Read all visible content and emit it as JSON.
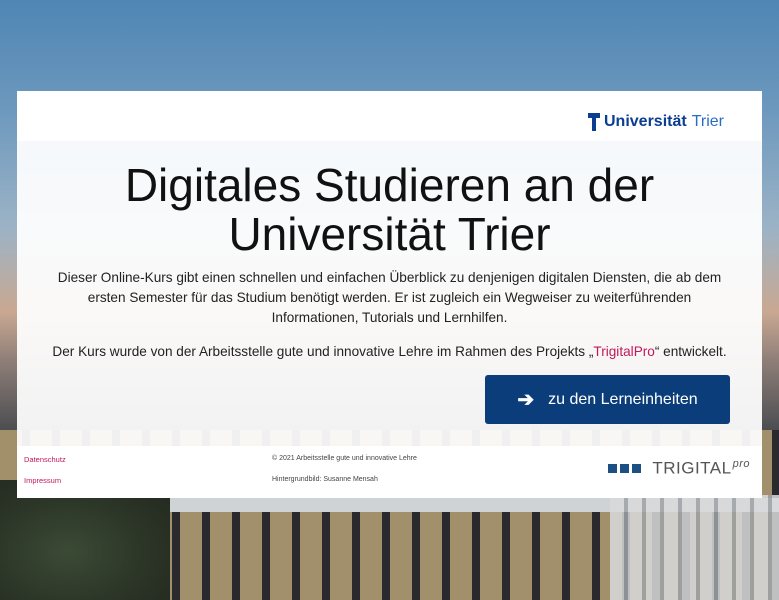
{
  "header": {
    "logo_text_bold": "Universität",
    "logo_text_light": "Trier"
  },
  "main": {
    "title_line1": "Digitales Studieren an der",
    "title_line2": "Universität Trier",
    "intro": "Dieser Online-Kurs gibt einen schnellen und einfachen Überblick zu denjenigen digitalen Diensten, die ab dem ersten Semester für das Studium benötigt werden. Er ist zugleich ein Wegweiser zu weiterführenden Informationen, Tutorials und Lernhilfen.",
    "credit_before": "Der Kurs wurde von der Arbeitsstelle gute und innovative Lehre im Rahmen des Projekts „",
    "credit_link": "TrigitalPro",
    "credit_after": "“ entwickelt.",
    "cta_label": "zu den Lerneinheiten",
    "cta_icon": "arrow-right-icon"
  },
  "footer": {
    "datenschutz": "Datenschutz",
    "impressum": "Impressum",
    "copyright": "© 2021 Arbeitsstelle gute und innovative Lehre",
    "background_credit": "Hintergrundbild: Susanne Mensah",
    "brand_name": "TRIGITAL",
    "brand_suffix": "pro"
  },
  "colors": {
    "accent": "#0b3d7a",
    "link": "#c2185b",
    "logo_blue": "#0b3d91"
  }
}
